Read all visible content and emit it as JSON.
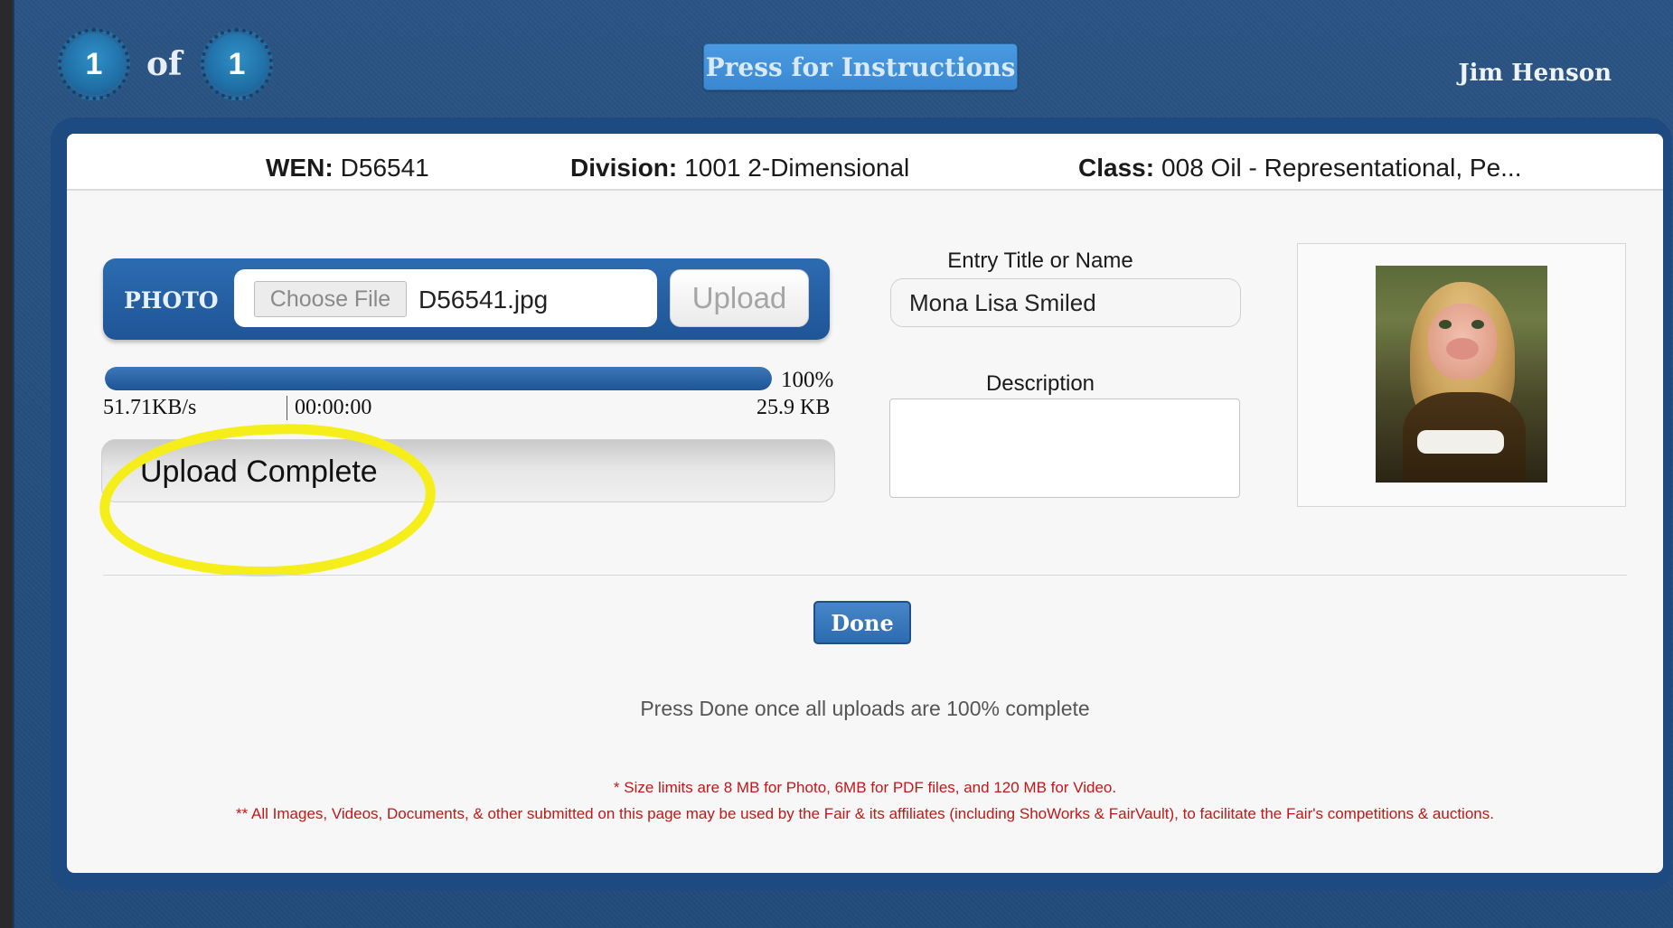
{
  "header": {
    "current_page": "1",
    "of_label": "of",
    "total_pages": "1",
    "instructions_button": "Press for Instructions",
    "user_name": "Jim Henson"
  },
  "entry": {
    "wen_label": "WEN:",
    "wen_value": "D56541",
    "division_label": "Division:",
    "division_value": "1001 2-Dimensional",
    "class_label": "Class:",
    "class_value": "008 Oil - Representational, Pe..."
  },
  "upload": {
    "section_label": "PHOTO",
    "choose_file_label": "Choose File",
    "file_name": "D56541.jpg",
    "upload_button": "Upload",
    "progress_percent": 100,
    "progress_text": "100%",
    "speed": "51.71KB/s",
    "elapsed": "00:00:00",
    "size": "25.9 KB",
    "status": "Upload Complete",
    "highlight_color": "#f5ee1a"
  },
  "fields": {
    "title_label": "Entry Title or Name",
    "title_value": "Mona Lisa Smiled",
    "description_label": "Description",
    "description_value": ""
  },
  "actions": {
    "done_button": "Done",
    "hint": "Press Done once all uploads are 100% complete"
  },
  "notes": {
    "size_limits": "* Size limits are 8 MB for Photo, 6MB for PDF files, and 120 MB for Video.",
    "usage": "** All Images, Videos, Documents, & other submitted on this page may be used by the Fair & its affiliates (including ShoWorks & FairVault), to facilitate the Fair's competitions & auctions."
  },
  "colors": {
    "accent_blue": "#2d6bb0",
    "note_red": "#c01818"
  }
}
